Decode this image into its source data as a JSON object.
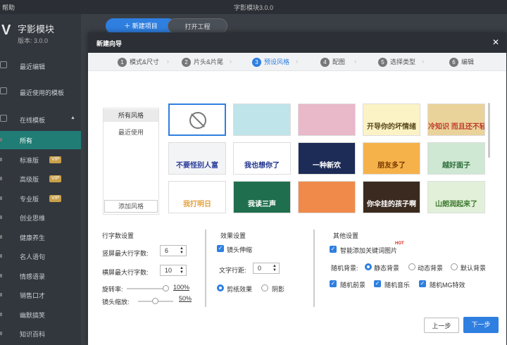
{
  "titlebar": {
    "menu": "帮助",
    "title": "字影模块3.0.0"
  },
  "sidebar": {
    "logo": "V",
    "app_name": "字影模块",
    "version": "版本: 3.0.0",
    "nav": [
      {
        "label": "最近编辑"
      },
      {
        "label": "最近使用的模板"
      },
      {
        "label": "在线模板"
      }
    ],
    "categories": [
      {
        "label": "所有",
        "vip": ""
      },
      {
        "label": "标准版",
        "vip": "VIP"
      },
      {
        "label": "高级版",
        "vip": "VIP"
      },
      {
        "label": "专业版",
        "vip": "VIP"
      },
      {
        "label": "创业思维",
        "vip": ""
      },
      {
        "label": "健康养生",
        "vip": ""
      },
      {
        "label": "名人语句",
        "vip": ""
      },
      {
        "label": "情感语录",
        "vip": ""
      },
      {
        "label": "销售口才",
        "vip": ""
      },
      {
        "label": "幽默搞笑",
        "vip": ""
      },
      {
        "label": "知识百科",
        "vip": ""
      }
    ]
  },
  "topbar": {
    "new_project": "＋ 新建项目",
    "open_project": "打开工程"
  },
  "dialog": {
    "title": "新建向导",
    "close": "✕"
  },
  "steps": [
    {
      "num": "1",
      "label": "模式&尺寸"
    },
    {
      "num": "2",
      "label": "片头&片尾"
    },
    {
      "num": "3",
      "label": "预设风格"
    },
    {
      "num": "4",
      "label": "配图"
    },
    {
      "num": "5",
      "label": "选择类型"
    },
    {
      "num": "6",
      "label": "编辑"
    }
  ],
  "active_step": 2,
  "style_list": {
    "items": [
      "所有风格",
      "最近使用"
    ],
    "selected": 0,
    "add_button": "添加风格"
  },
  "templates": [
    {
      "text": "",
      "bg": "#ffffff",
      "color": "#777",
      "icon": "no-symbol-icon",
      "selected": true
    },
    {
      "text": "",
      "bg": "#bfe4ea",
      "color": "#333"
    },
    {
      "text": "",
      "bg": "#e9b8c9",
      "color": "#fff"
    },
    {
      "text": "开导你的坏情绪",
      "bg": "#fbf3c6",
      "color": "#5a4a1c"
    },
    {
      "text": "冷知识 而且还不轻",
      "bg": "#e9d39a",
      "color": "#c0392b"
    },
    {
      "text": "不要怪别人富",
      "bg": "#f3f4f6",
      "color": "#2c3e9a"
    },
    {
      "text": "我也想你了",
      "bg": "#ffffff",
      "color": "#1a2f8a"
    },
    {
      "text": "一种新欢",
      "bg": "#1d2b57",
      "color": "#ffffff"
    },
    {
      "text": "朋友多了",
      "bg": "#f6b24a",
      "color": "#7a3b00"
    },
    {
      "text": "越好面子",
      "bg": "#cfe8d3",
      "color": "#2d6e3a"
    },
    {
      "text": "我打明日",
      "bg": "#ffffff",
      "color": "#e6a23c"
    },
    {
      "text": "我读三声",
      "bg": "#1f6f4f",
      "color": "#ffffff"
    },
    {
      "text": "",
      "bg": "#f08a4b",
      "color": "#ffffff"
    },
    {
      "text": "你伞挂的孩子啊",
      "bg": "#3b2a1f",
      "color": "#ffffff"
    },
    {
      "text": "山朗润起来了",
      "bg": "#e2f0d9",
      "color": "#3d7a2e"
    }
  ],
  "text_settings": {
    "title": "行字数设置",
    "vertical_max": {
      "label": "竖屏最大行字数:",
      "value": "6"
    },
    "horizontal_max": {
      "label": "横屏最大行字数:",
      "value": "10"
    },
    "rotation": {
      "label": "旋转率:",
      "percent": "100%",
      "level": 1.0
    },
    "zoom": {
      "label": "镜头缩放:",
      "percent": "50%",
      "level": 0.5
    }
  },
  "effect_settings": {
    "title": "效果设置",
    "lens_stretch": "镜头伸缩",
    "line_spacing": {
      "label": "文字行距:",
      "value": "0"
    },
    "cut_effect": "剪纸效果",
    "shadow": "阴影"
  },
  "other_settings": {
    "title": "其他设置",
    "auto_keyword": "智能添加关键词图片",
    "hot_badge": "HOT",
    "bg_label": "随机背景:",
    "bg_options": [
      "静态背景",
      "动态背景",
      "默认背景"
    ],
    "bg_selected": 0,
    "random_foreground": "随机前景",
    "random_music": "随机音乐",
    "random_mg": "随机MG特效"
  },
  "footer": {
    "prev": "上一步",
    "next": "下一步"
  }
}
